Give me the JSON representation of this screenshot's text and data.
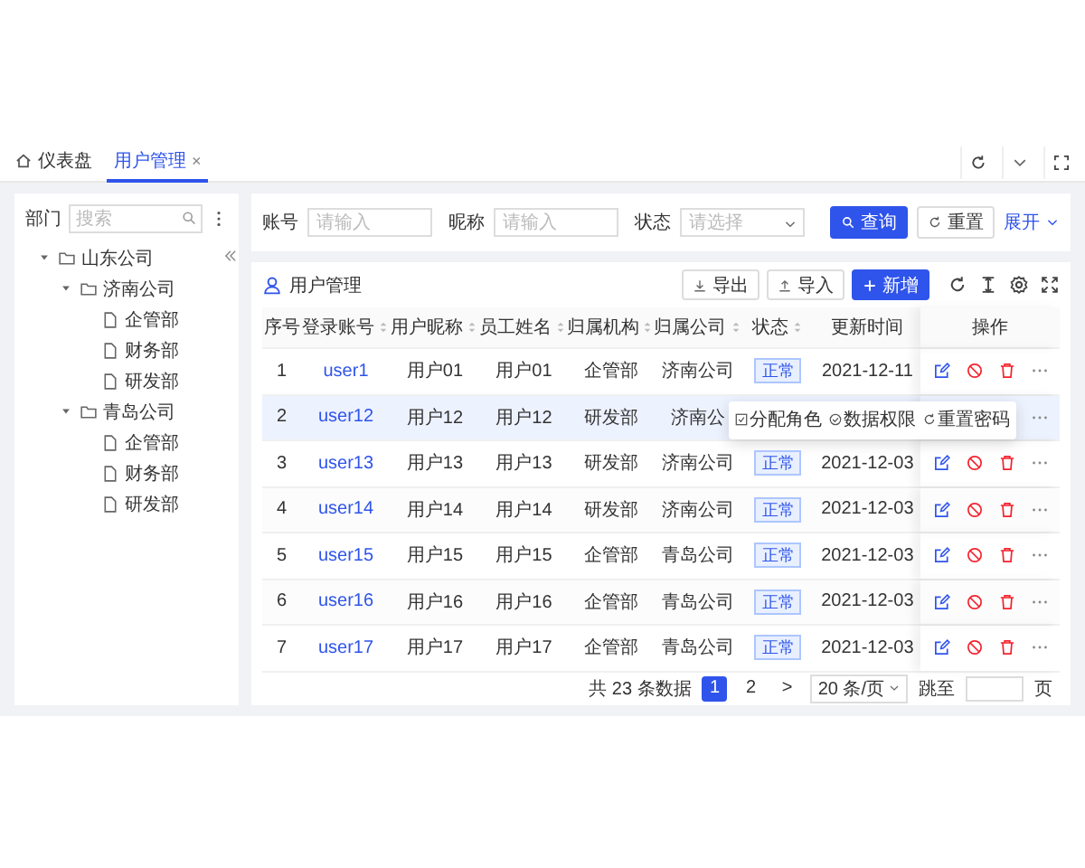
{
  "tabs": [
    {
      "label": "仪表盘",
      "kind": "home",
      "selected": false,
      "closable": false
    },
    {
      "label": "用户管理",
      "kind": "page",
      "selected": true,
      "closable": true
    }
  ],
  "tabs_close": "×",
  "sidebar": {
    "title": "部门",
    "search": {
      "placeholder": "搜索"
    },
    "tree": [
      {
        "label": "山东公司",
        "kind": "folder",
        "expanded": true,
        "children": [
          {
            "label": "济南公司",
            "kind": "folder",
            "expanded": true,
            "children": [
              {
                "label": "企管部",
                "kind": "file"
              },
              {
                "label": "财务部",
                "kind": "file"
              },
              {
                "label": "研发部",
                "kind": "file"
              }
            ]
          },
          {
            "label": "青岛公司",
            "kind": "folder",
            "expanded": true,
            "children": [
              {
                "label": "企管部",
                "kind": "file"
              },
              {
                "label": "财务部",
                "kind": "file"
              },
              {
                "label": "研发部",
                "kind": "file"
              }
            ]
          }
        ]
      }
    ]
  },
  "filters": {
    "fields": [
      {
        "label": "账号",
        "kind": "input",
        "placeholder": "请输入"
      },
      {
        "label": "昵称",
        "kind": "input",
        "placeholder": "请输入"
      },
      {
        "label": "状态",
        "kind": "select",
        "placeholder": "请选择"
      }
    ],
    "query": "查询",
    "reset": "重置",
    "expand": "展开"
  },
  "table": {
    "title": "用户管理",
    "export": "导出",
    "import": "导入",
    "add": "新增",
    "columns": [
      {
        "label": "序号",
        "sortable": false
      },
      {
        "label": "登录账号",
        "sortable": true
      },
      {
        "label": "用户昵称",
        "sortable": true
      },
      {
        "label": "员工姓名",
        "sortable": true
      },
      {
        "label": "归属机构",
        "sortable": true
      },
      {
        "label": "归属公司",
        "sortable": true
      },
      {
        "label": "状态",
        "sortable": true
      },
      {
        "label": "更新时间",
        "sortable": false
      },
      {
        "label": "操作",
        "sortable": false
      }
    ],
    "rows": [
      {
        "no": "1",
        "account": "user1",
        "nickname": "用户01",
        "name": "用户01",
        "org": "企管部",
        "company": "济南公司",
        "status": "正常",
        "updated": "2021-12-11",
        "selected": false
      },
      {
        "no": "2",
        "account": "user12",
        "nickname": "用户12",
        "name": "用户12",
        "org": "研发部",
        "company": "济南公",
        "selected": true,
        "menu": [
          "分配角色",
          "数据权限",
          "重置密码"
        ]
      },
      {
        "no": "3",
        "account": "user13",
        "nickname": "用户13",
        "name": "用户13",
        "org": "研发部",
        "company": "济南公司",
        "status": "正常",
        "updated": "2021-12-03",
        "selected": false
      },
      {
        "no": "4",
        "account": "user14",
        "nickname": "用户14",
        "name": "用户14",
        "org": "研发部",
        "company": "济南公司",
        "status": "正常",
        "updated": "2021-12-03",
        "selected": false
      },
      {
        "no": "5",
        "account": "user15",
        "nickname": "用户15",
        "name": "用户15",
        "org": "企管部",
        "company": "青岛公司",
        "status": "正常",
        "updated": "2021-12-03",
        "selected": false
      },
      {
        "no": "6",
        "account": "user16",
        "nickname": "用户16",
        "name": "用户16",
        "org": "企管部",
        "company": "青岛公司",
        "status": "正常",
        "updated": "2021-12-03",
        "selected": false
      },
      {
        "no": "7",
        "account": "user17",
        "nickname": "用户17",
        "name": "用户17",
        "org": "企管部",
        "company": "青岛公司",
        "status": "正常",
        "updated": "2021-12-03",
        "selected": false
      }
    ]
  },
  "pagination": {
    "total": "共 23 条数据",
    "pages": [
      {
        "label": "1",
        "selected": true
      },
      {
        "label": "2",
        "selected": false
      }
    ],
    "next": ">",
    "page_size": "20 条/页",
    "jump": "跳至",
    "unit": "页"
  }
}
